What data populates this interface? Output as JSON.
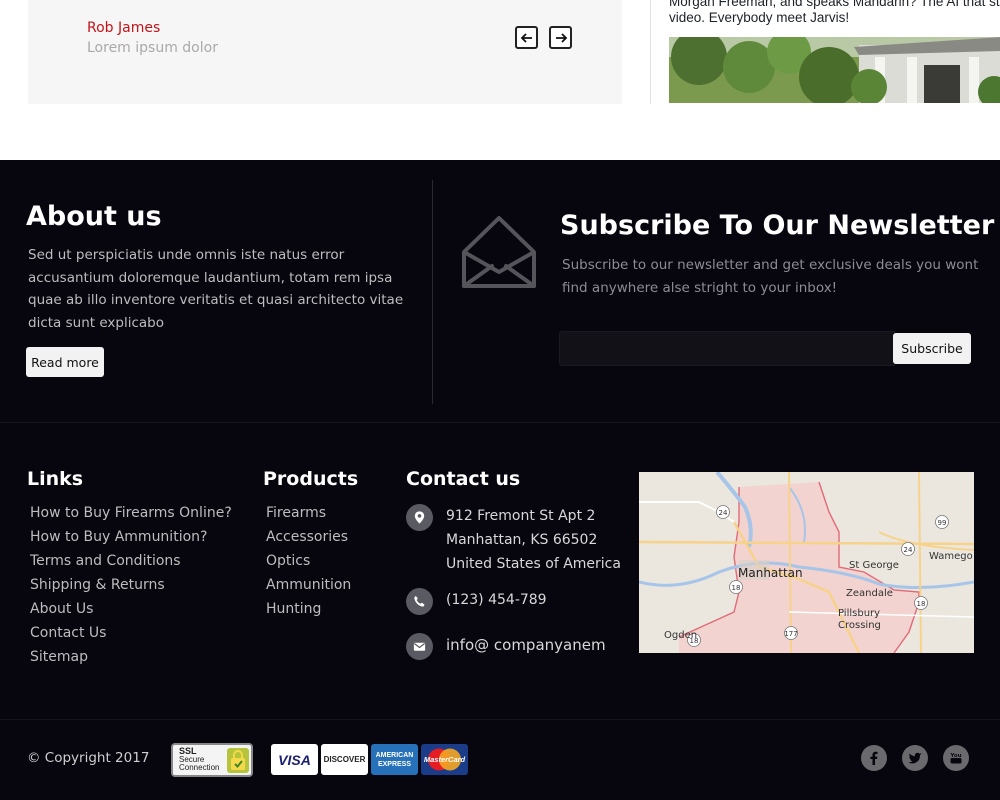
{
  "testimonial": {
    "name": "Rob James",
    "role": "Lorem ipsum dolor",
    "prev_icon": "arrow-left-icon",
    "next_icon": "arrow-right-icon"
  },
  "fb_post": {
    "caption_line1": "Morgan Freeman, and speaks Mandarin? The AI that st",
    "caption_line2": "video. Everybody meet Jarvis!"
  },
  "about": {
    "title": "About us",
    "text": "Sed ut perspiciatis unde omnis iste natus error accusantium doloremque laudantium, totam rem ipsa quae ab illo inventore veritatis et quasi architecto vitae dicta sunt explicabo",
    "button": "Read more"
  },
  "newsletter": {
    "icon": "envelope-icon",
    "title": "Subscribe To Our Newsletter",
    "subtitle": "Subscribe to our newsletter and get exclusive deals you wont find anywhere alse stright to your inbox!",
    "input_placeholder": "",
    "button": "Subscribe"
  },
  "links": {
    "title": "Links",
    "items": [
      "How to Buy Firearms Online?",
      "How to Buy Ammunition?",
      "Terms and Conditions",
      "Shipping & Returns",
      "About Us",
      "Contact Us",
      "Sitemap"
    ]
  },
  "products": {
    "title": "Products",
    "items": [
      "Firearms",
      "Accessories",
      "Optics",
      "Ammunition",
      "Hunting"
    ]
  },
  "contact": {
    "title": "Contact us",
    "address_line1": "912 Fremont St Apt 2",
    "address_line2": "Manhattan, KS 66502",
    "address_line3": "United States of America",
    "phone": "(123) 454-789",
    "email": "info@ companyanem",
    "icons": [
      "map-pin-icon",
      "phone-icon",
      "mail-icon"
    ]
  },
  "map": {
    "labels": {
      "manhattan": "Manhattan",
      "st_george": "St George",
      "wamego": "Wamego",
      "zeandale": "Zeandale",
      "pillsbury1": "Pillsbury",
      "pillsbury2": "Crossing",
      "ogden": "Ogden"
    },
    "routes": [
      "24",
      "99",
      "24",
      "18",
      "18",
      "177",
      "18"
    ]
  },
  "bottom": {
    "copyright": "© Copyright 2017",
    "ssl_line1": "SSL",
    "ssl_line2": "Secure",
    "ssl_line3": "Connection",
    "cards": {
      "visa": "VISA",
      "discover": "DISCOVER",
      "amex1": "AMERICAN",
      "amex2": "EXPRESS",
      "mastercard": "MasterCard"
    },
    "social_icons": [
      "facebook-icon",
      "twitter-icon",
      "youtube-icon"
    ]
  },
  "colors": {
    "accent_red": "#c1141a",
    "footer_bg": "#07060f"
  }
}
